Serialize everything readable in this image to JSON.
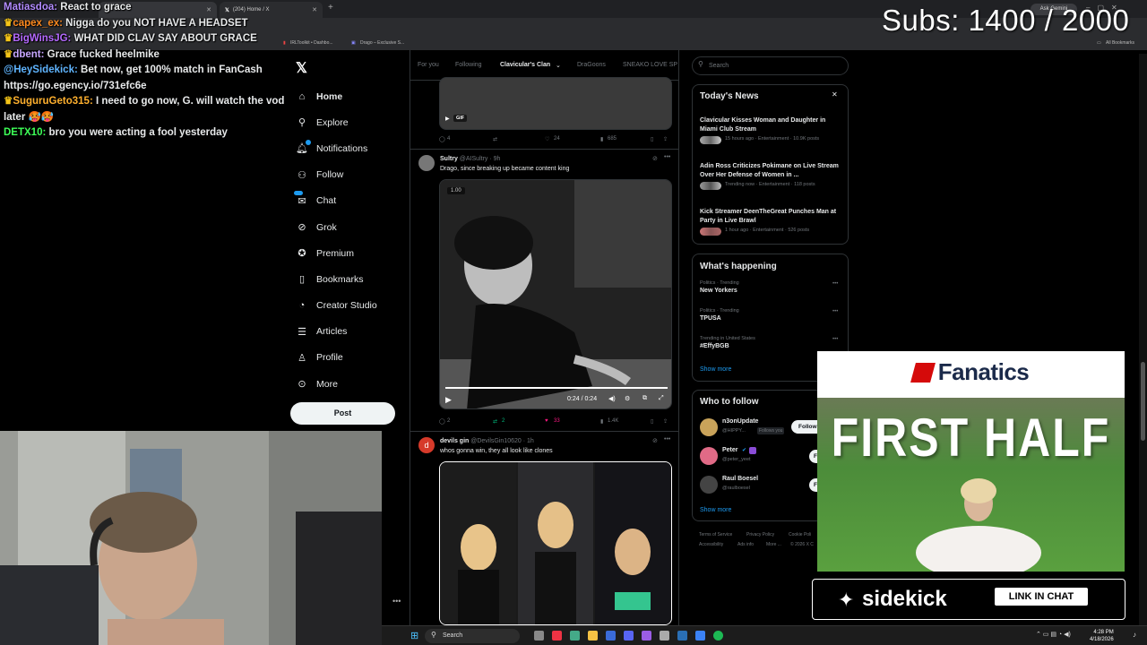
{
  "overlay": {
    "subs": "Subs: 1400 / 2000",
    "chat": [
      {
        "user": "Matiasdoa:",
        "text": "React to grace",
        "color": "#b38cff"
      },
      {
        "user": "capex_ex:",
        "text": "Nigga do you NOT HAVE A HEADSET",
        "color": "#ff8a1f"
      },
      {
        "user": "BigWinsJG:",
        "text": "WHAT DID CLAV SAY ABOUT GRACE",
        "color": "#b569ff"
      },
      {
        "user": "dbent:",
        "text": "Grace fucked heelmike",
        "color": "#c7a6ff"
      },
      {
        "user": "@HeySidekick:",
        "text": "Bet now, get 100% match in FanCash https://go.egency.io/731efc6e",
        "color": "#5fb4ff"
      },
      {
        "user": "SuguruGeto315:",
        "text": "I need to go now, G. will watch the vod later",
        "color": "#ffb02e"
      },
      {
        "user": "DETX10:",
        "text": "bro you were acting a fool yesterday",
        "color": "#3dff57"
      }
    ]
  },
  "browser": {
    "tabs": [
      {
        "title": "(204) Home / X"
      }
    ],
    "bookmarks": [
      "IRLToolkit • Dashbo...",
      "Drago – Exclusive S...",
      "All Bookmarks"
    ],
    "gemini": "Ask Gemini"
  },
  "nav": {
    "items": [
      {
        "label": "Home",
        "icon": "home-icon"
      },
      {
        "label": "Explore",
        "icon": "search-icon"
      },
      {
        "label": "Notifications",
        "icon": "bell-icon"
      },
      {
        "label": "Follow",
        "icon": "add-person-icon"
      },
      {
        "label": "Chat",
        "icon": "chat-icon"
      },
      {
        "label": "Grok",
        "icon": "grok-icon"
      },
      {
        "label": "Premium",
        "icon": "premium-icon"
      },
      {
        "label": "Bookmarks",
        "icon": "bookmark-icon"
      },
      {
        "label": "Creator Studio",
        "icon": "creator-studio-icon"
      },
      {
        "label": "Articles",
        "icon": "articles-icon"
      },
      {
        "label": "Profile",
        "icon": "profile-icon"
      },
      {
        "label": "More",
        "icon": "more-icon"
      }
    ],
    "post_label": "Post"
  },
  "feed": {
    "tabs": [
      "For you",
      "Following",
      "Clavicular's Clan",
      "DraGoons",
      "SNEAKO LOVE SP"
    ],
    "post0": {
      "badge": "GIF",
      "replies": "4",
      "likes": "24",
      "views": "685"
    },
    "post1": {
      "name": "Sultry",
      "handle": "@AISultry · 9h",
      "text": "Drago, since breaking up became content king",
      "speed": "1.00",
      "time": "0:24 / 0:24",
      "replies": "2",
      "reposts": "2",
      "likes": "33",
      "views": "1.4K"
    },
    "post2": {
      "name": "devils gin",
      "handle": "@DevilsGin10620 · 1h",
      "text": "whos gonna win, they all look like clones"
    }
  },
  "right": {
    "search_placeholder": "Search",
    "news_title": "Today's News",
    "news": [
      {
        "title": "Clavicular Kisses Woman and Daughter in Miami Club Stream",
        "meta": "15 hours ago · Entertainment · 10.9K posts"
      },
      {
        "title": "Adin Ross Criticizes Pokimane on Live Stream Over Her Defense of Women in ...",
        "meta": "Trending now · Entertainment · 118 posts"
      },
      {
        "title": "Kick Streamer DeenTheGreat Punches Man at Party in Live Brawl",
        "meta": "1 hour ago · Entertainment · 526 posts"
      }
    ],
    "happening_title": "What's happening",
    "trends": [
      {
        "cat": "Politics · Trending",
        "name": "New Yorkers"
      },
      {
        "cat": "Politics · Trending",
        "name": "TPUSA"
      },
      {
        "cat": "Trending in United States",
        "name": "#EffyBGB"
      }
    ],
    "show_more": "Show more",
    "wtf_title": "Who to follow",
    "follow": [
      {
        "name": "n3onUpdate",
        "handle": "@HIPPY...",
        "note": "Follows you",
        "btn": "Follow"
      },
      {
        "name": "Peter",
        "handle": "@peter_yeet",
        "btn": "F"
      },
      {
        "name": "Raul Boesel",
        "handle": "@raulboesel",
        "btn": "F"
      }
    ],
    "footer": [
      "Terms of Service",
      "Privacy Policy",
      "Cookie Poli",
      "Accessibility",
      "Ads info",
      "More ...",
      "© 2026 X C"
    ]
  },
  "ad": {
    "brand": "Fanatics",
    "headline": "FIRST HALF",
    "sidekick": "sidekick",
    "cta": "LINK IN CHAT"
  },
  "taskbar": {
    "search": "Search",
    "time": "4:28 PM",
    "date": "4/18/2026"
  }
}
